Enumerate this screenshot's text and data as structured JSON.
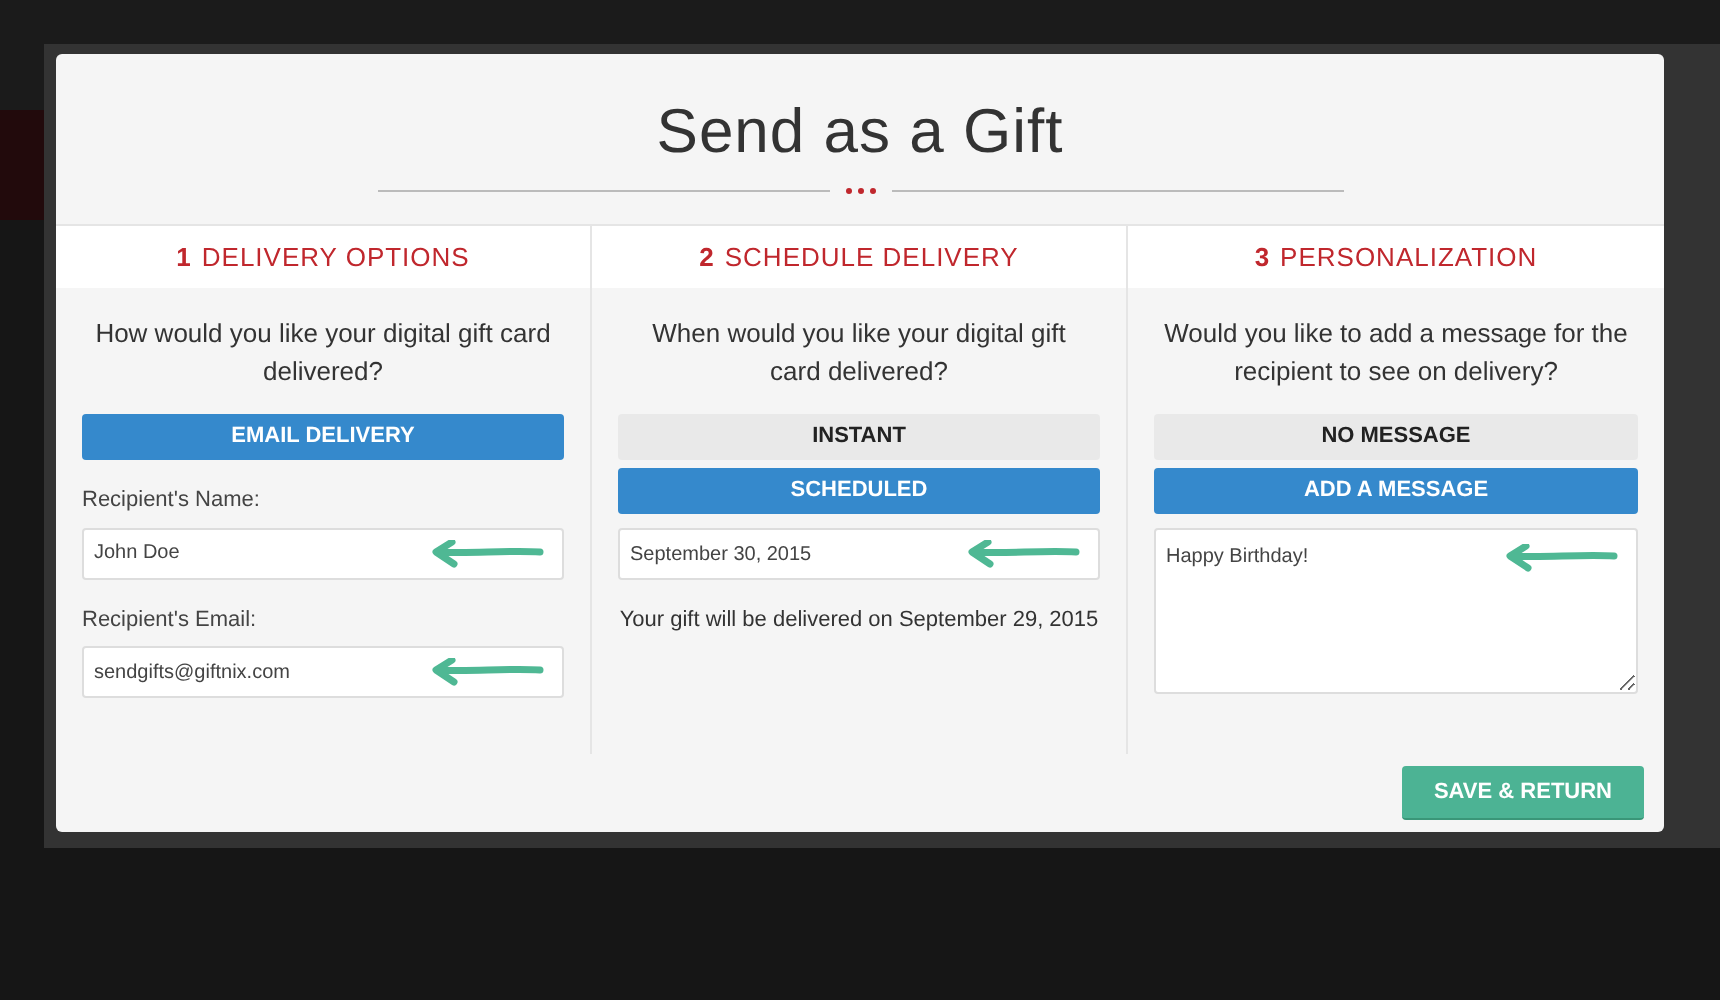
{
  "modal": {
    "title": "Send as a Gift",
    "steps": [
      {
        "number": "1",
        "title": "DELIVERY OPTIONS",
        "question": "How would you like your digital gift card delivered?",
        "options": [
          {
            "label": "EMAIL DELIVERY",
            "selected": true
          }
        ],
        "fields": [
          {
            "kind": "input",
            "label": "Recipient's Name:",
            "value": "John Doe"
          },
          {
            "kind": "input",
            "label": "Recipient's Email:",
            "value": "sendgifts@giftnix.com"
          }
        ]
      },
      {
        "number": "2",
        "title": "SCHEDULE DELIVERY",
        "question": "When would you like your digital gift card delivered?",
        "options": [
          {
            "label": "INSTANT",
            "selected": false
          },
          {
            "label": "SCHEDULED",
            "selected": true
          }
        ],
        "fields": [
          {
            "kind": "input",
            "value": "September 30, 2015"
          }
        ],
        "note": "Your gift will be delivered on September 29, 2015"
      },
      {
        "number": "3",
        "title": "PERSONALIZATION",
        "question": "Would you like to add a message for the recipient to see on delivery?",
        "options": [
          {
            "label": "NO MESSAGE",
            "selected": false
          },
          {
            "label": "ADD A MESSAGE",
            "selected": true
          }
        ],
        "fields": [
          {
            "kind": "textarea",
            "value": "Happy Birthday!"
          }
        ]
      }
    ],
    "save_button": "SAVE & RETURN"
  }
}
